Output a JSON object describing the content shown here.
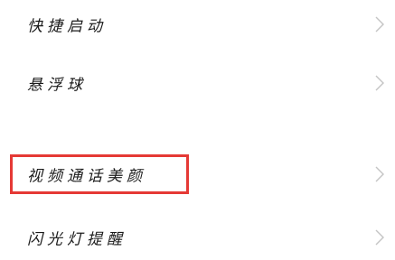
{
  "settings": {
    "items": [
      {
        "label": "快捷启动",
        "icon": "chevron-right-icon"
      },
      {
        "label": "悬浮球",
        "icon": "chevron-right-icon"
      },
      {
        "label": "视频通话美颜",
        "icon": "chevron-right-icon",
        "highlighted": true
      },
      {
        "label": "闪光灯提醒",
        "icon": "chevron-right-icon"
      }
    ]
  },
  "colors": {
    "background": "#ffffff",
    "text": "#1a1a1a",
    "chevron": "#c4c4c4",
    "highlight": "#e53935"
  }
}
